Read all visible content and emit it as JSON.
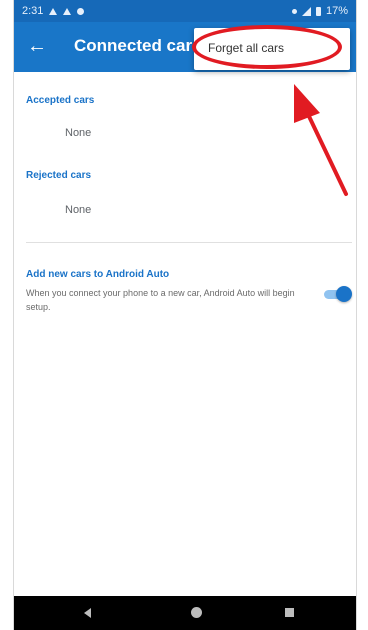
{
  "status_bar": {
    "time": "2:31",
    "battery": "17%"
  },
  "app_bar": {
    "back_icon": "arrow-back-icon",
    "title": "Connected cars"
  },
  "overflow_menu": {
    "items": [
      {
        "label": "Forget all cars"
      }
    ]
  },
  "sections": {
    "accepted": {
      "header": "Accepted cars",
      "value": "None"
    },
    "rejected": {
      "header": "Rejected cars",
      "value": "None"
    }
  },
  "setting": {
    "title": "Add new cars to Android Auto",
    "description": "When you connect your phone to a new car, Android Auto will begin setup.",
    "enabled": true
  },
  "nav_bar": {
    "icons": [
      "nav-back-icon",
      "nav-home-icon",
      "nav-recent-icon"
    ]
  },
  "annotation": {
    "color": "#e11b22"
  },
  "colors": {
    "app_bar": "#1976c8",
    "status_bar": "#1669b8",
    "accent": "#1a73c8"
  }
}
